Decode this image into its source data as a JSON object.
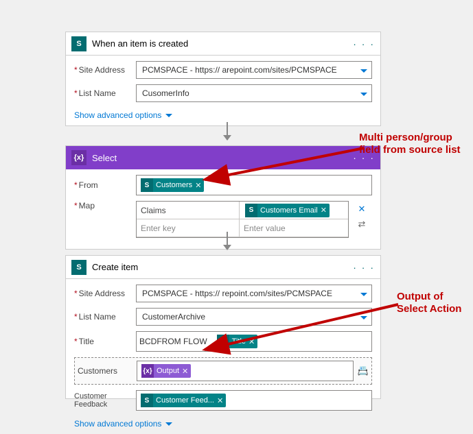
{
  "trigger": {
    "title": "When an item is created",
    "site_label": "Site Address",
    "site_value": "PCMSPACE - https://         arepoint.com/sites/PCMSPACE",
    "list_label": "List Name",
    "list_value": "CusomerInfo",
    "advanced": "Show advanced options"
  },
  "select": {
    "title": "Select",
    "from_label": "From",
    "from_token": "Customers",
    "map_label": "Map",
    "map_rows": [
      {
        "key": "Claims",
        "val_token": "Customers Email"
      },
      {
        "key_placeholder": "Enter key",
        "val_placeholder": "Enter value"
      }
    ]
  },
  "create": {
    "title": "Create item",
    "site_label": "Site Address",
    "site_value": "PCMSPACE - https://         repoint.com/sites/PCMSPACE",
    "list_label": "List Name",
    "list_value": "CustomerArchive",
    "title_label": "Title",
    "title_text": "BCDFROM FLOW _",
    "title_token": "Title",
    "customers_label": "Customers",
    "customers_token": "Output",
    "feedback_label": "Customer Feedback",
    "feedback_token": "Customer Feed...",
    "advanced": "Show advanced options"
  },
  "annot": {
    "a1_l1": "Multi person/group",
    "a1_l2": "field from source list",
    "a2_l1": "Output of",
    "a2_l2": "Select Action"
  },
  "icons": {
    "sp": "S",
    "sel": "{x}",
    "close": "✕",
    "switch": "⇄",
    "picker": "📇"
  }
}
